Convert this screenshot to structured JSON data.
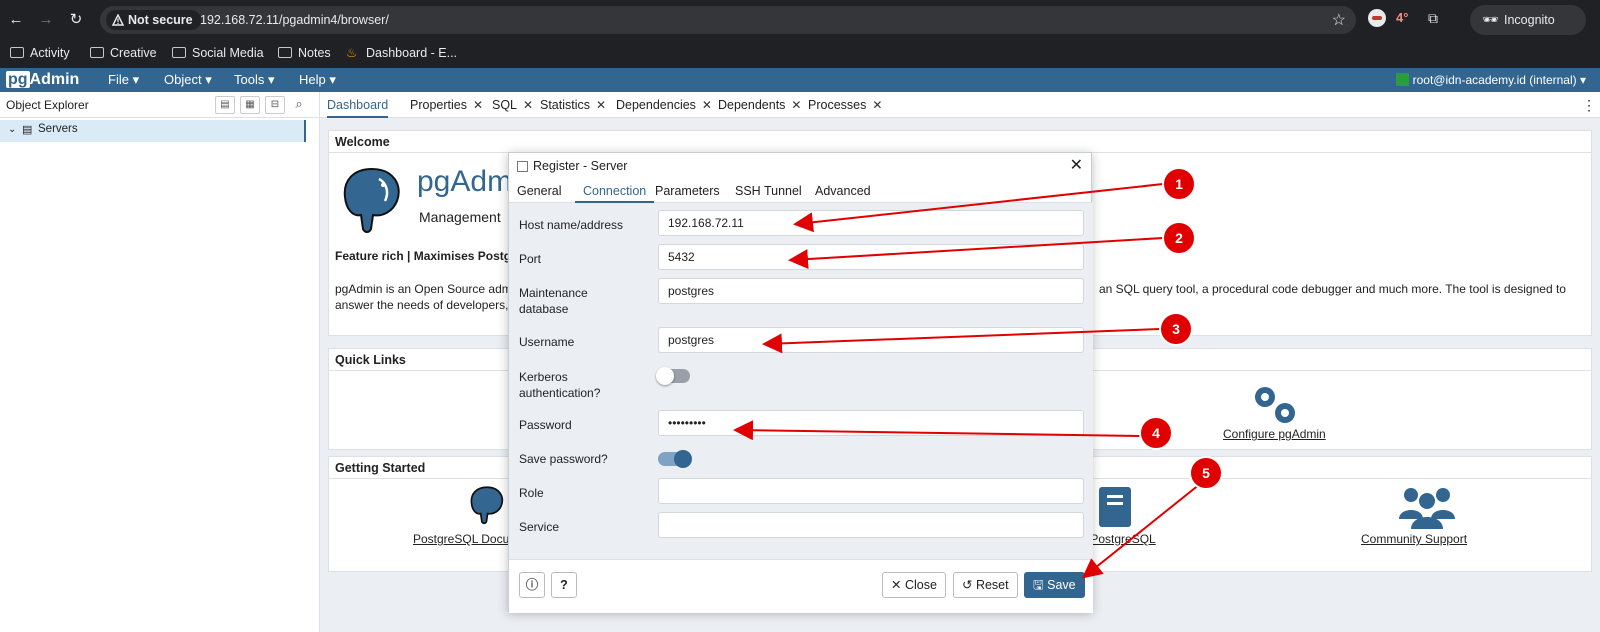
{
  "browser": {
    "security_label": "Not secure",
    "url": "192.168.72.11/pgadmin4/browser/",
    "ext_badge": "4°",
    "incognito_label": "Incognito",
    "bookmarks": [
      "Activity",
      "Creative",
      "Social Media",
      "Notes",
      "Dashboard - E..."
    ]
  },
  "app": {
    "logo_pg": "pg",
    "logo_admin": "Admin",
    "menus": [
      "File",
      "Object",
      "Tools",
      "Help"
    ],
    "user": "root@idn-academy.id (internal)"
  },
  "explorer": {
    "title": "Object Explorer",
    "servers_label": "Servers"
  },
  "tabs": [
    "Dashboard",
    "Properties",
    "SQL",
    "Statistics",
    "Dependencies",
    "Dependents",
    "Processes"
  ],
  "dashboard": {
    "welcome_header": "Welcome",
    "logo_text": "pgAdm",
    "logo_sub": "Management",
    "feature_line": "Feature rich | Maximises Postgre",
    "desc_left_1": "pgAdmin is an Open Source adm",
    "desc_left_2": "answer the needs of developers,",
    "desc_right_1": "an SQL query tool, a procedural code debugger and much more. The tool is designed to",
    "quick_links_header": "Quick Links",
    "configure_label": "Configure pgAdmin",
    "getting_started_header": "Getting Started",
    "pg_docs_label": "PostgreSQL Docu",
    "planet_label": "et PostgreSQL",
    "community_label": "Community Support"
  },
  "dialog": {
    "title": "Register - Server",
    "tabs": [
      "General",
      "Connection",
      "Parameters",
      "SSH Tunnel",
      "Advanced"
    ],
    "fields": {
      "host_label": "Host name/address",
      "host_value": "192.168.72.11",
      "port_label": "Port",
      "port_value": "5432",
      "maint_label_1": "Maintenance",
      "maint_label_2": "database",
      "maint_value": "postgres",
      "username_label": "Username",
      "username_value": "postgres",
      "kerberos_label_1": "Kerberos",
      "kerberos_label_2": "authentication?",
      "password_label": "Password",
      "password_value": "•••••••••",
      "save_password_label": "Save password?",
      "role_label": "Role",
      "service_label": "Service"
    },
    "toggles": {
      "kerberos": false,
      "save_password": true
    },
    "buttons": {
      "close": "Close",
      "reset": "Reset",
      "save": "Save"
    }
  },
  "annotations": [
    "1",
    "2",
    "3",
    "4",
    "5"
  ],
  "colors": {
    "brand": "#326690",
    "annotation": "#e00000"
  }
}
